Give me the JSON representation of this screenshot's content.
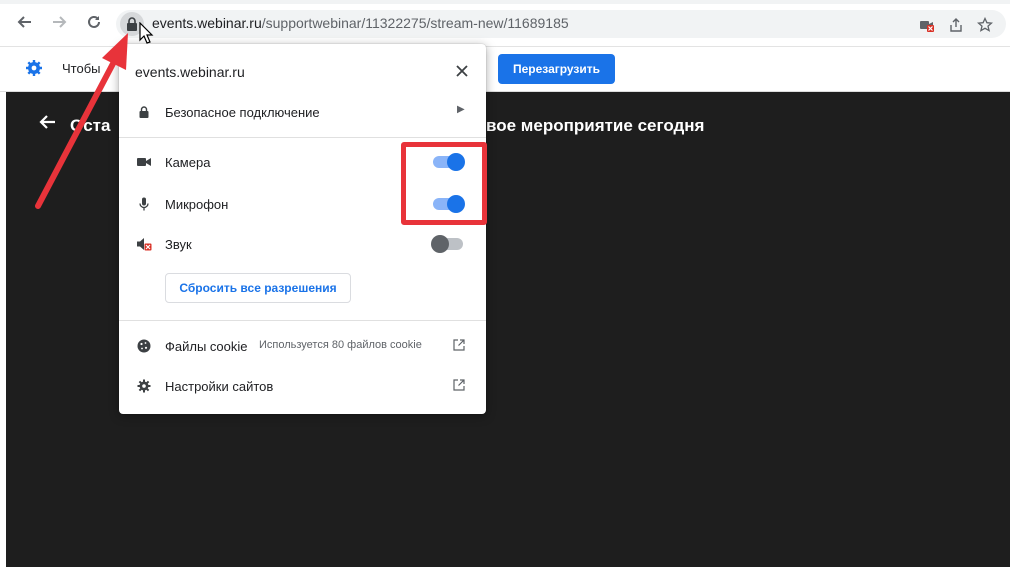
{
  "browser": {
    "url_host": "events.webinar.ru",
    "url_path": "/supportwebinar/11322275/stream-new/11689185",
    "icons": [
      "back-icon",
      "forward-icon",
      "reload-icon",
      "lock-icon",
      "camera-blocked-icon",
      "share-icon",
      "bookmark-star-icon"
    ]
  },
  "infobar": {
    "text": "Чтобы",
    "reload_button": "Перезагрузить",
    "accent": "#1a73e8"
  },
  "content": {
    "left_text": "Оста",
    "title": "вое мероприятие сегодня"
  },
  "popup": {
    "host": "events.webinar.ru",
    "connection_label": "Безопасное подключение",
    "permissions": [
      {
        "label": "Камера",
        "icon": "camera-icon",
        "enabled": true
      },
      {
        "label": "Микрофон",
        "icon": "microphone-icon",
        "enabled": true
      },
      {
        "label": "Звук",
        "icon": "sound-muted-icon",
        "enabled": false
      }
    ],
    "reset_button": "Сбросить все разрешения",
    "cookies_label": "Файлы cookie",
    "cookies_detail": "Используется 80 файлов cookie",
    "site_settings_label": "Настройки сайтов"
  },
  "annotation_color": "#e8333a"
}
